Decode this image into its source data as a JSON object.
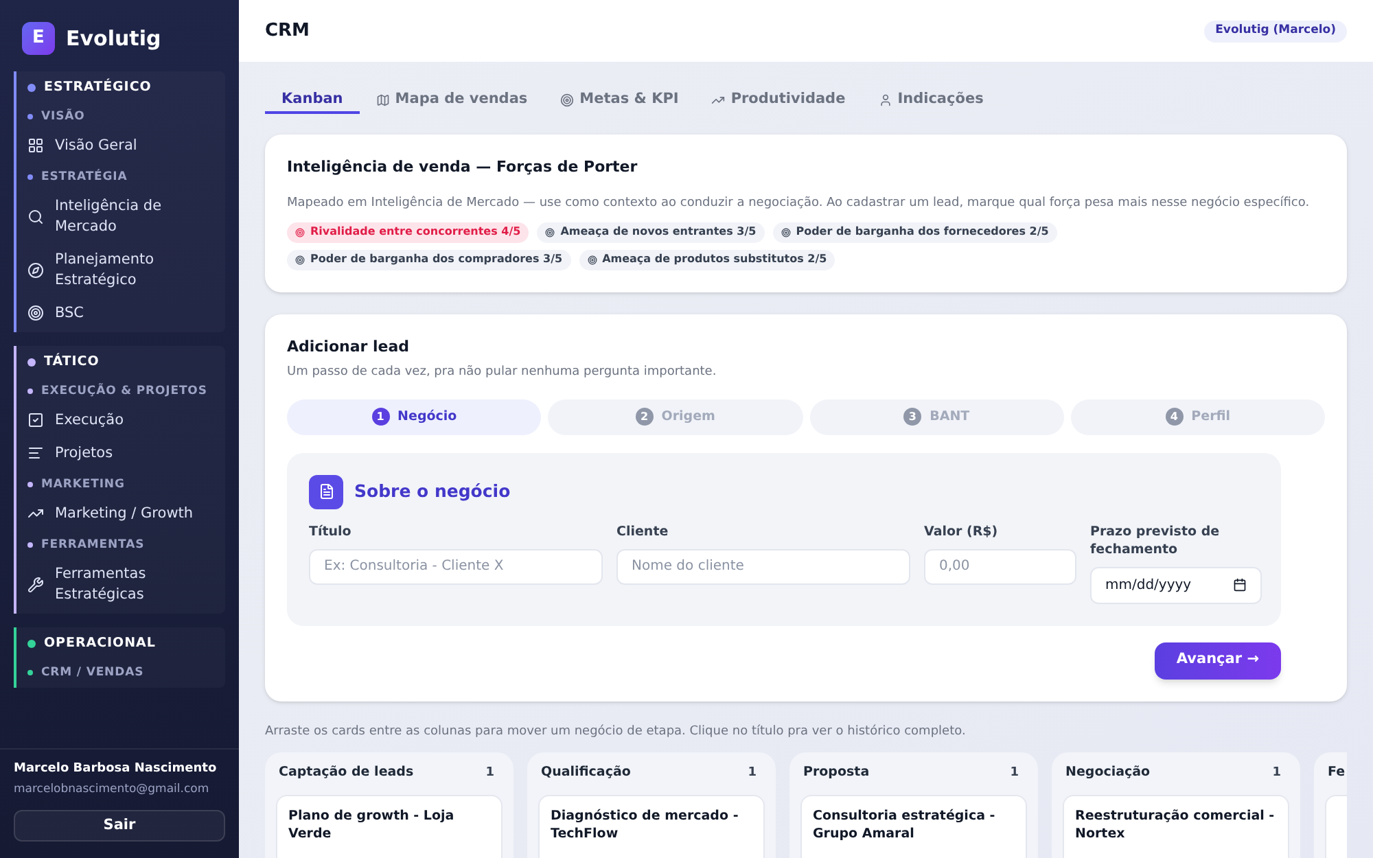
{
  "sidebar": {
    "brand": {
      "letter": "E",
      "name": "Evolutig"
    },
    "groups": [
      {
        "title": "ESTRATÉGICO",
        "color": "#818cf8",
        "sections": [
          {
            "title": "VISÃO",
            "items": [
              {
                "label": "Visão Geral"
              }
            ]
          },
          {
            "title": "ESTRATÉGIA",
            "items": [
              {
                "label": "Inteligência de Mercado"
              },
              {
                "label": "Planejamento Estratégico"
              },
              {
                "label": "BSC"
              }
            ]
          }
        ]
      },
      {
        "title": "TÁTICO",
        "color": "#c4b5fd",
        "sections": [
          {
            "title": "EXECUÇÃO & PROJETOS",
            "items": [
              {
                "label": "Execução"
              },
              {
                "label": "Projetos"
              }
            ]
          },
          {
            "title": "MARKETING",
            "items": [
              {
                "label": "Marketing / Growth"
              }
            ]
          },
          {
            "title": "FERRAMENTAS",
            "items": [
              {
                "label": "Ferramentas Estratégicas"
              }
            ]
          }
        ]
      },
      {
        "title": "OPERACIONAL",
        "color": "#34d399",
        "sections": [
          {
            "title": "CRM / VENDAS"
          }
        ]
      }
    ],
    "user": {
      "name": "Marcelo Barbosa Nascimento",
      "email": "marcelobnascimento@gmail.com",
      "logout": "Sair"
    }
  },
  "header": {
    "title": "CRM",
    "badge": "Evolutig (Marcelo)"
  },
  "tabs": [
    {
      "label": "Kanban",
      "selected": true
    },
    {
      "label": "Mapa de vendas",
      "selected": false
    },
    {
      "label": "Metas & KPI",
      "selected": false
    },
    {
      "label": "Produtividade",
      "selected": false
    },
    {
      "label": "Indicações",
      "selected": false
    }
  ],
  "porter": {
    "title": "Inteligência de venda — Forças de Porter",
    "description": "Mapeado em Inteligência de Mercado — use como contexto ao conduzir a negociação. Ao cadastrar um lead, marque qual força pesa mais nesse negócio específico.",
    "forces": [
      {
        "label": "Rivalidade entre concorrentes 4/5",
        "highlighted": true
      },
      {
        "label": "Ameaça de novos entrantes 3/5",
        "highlighted": false
      },
      {
        "label": "Poder de barganha dos fornecedores 2/5",
        "highlighted": false
      },
      {
        "label": "Poder de barganha dos compradores 3/5",
        "highlighted": false
      },
      {
        "label": "Ameaça de produtos substitutos 2/5",
        "highlighted": false
      }
    ]
  },
  "lead_form": {
    "title": "Adicionar lead",
    "subtitle": "Um passo de cada vez, pra não pular nenhuma pergunta importante.",
    "steps": [
      {
        "number": "1",
        "label": "Negócio",
        "selected": true
      },
      {
        "number": "2",
        "label": "Origem",
        "selected": false
      },
      {
        "number": "3",
        "label": "BANT",
        "selected": false
      },
      {
        "number": "4",
        "label": "Perfil",
        "selected": false
      }
    ],
    "section_title": "Sobre o negócio",
    "fields": [
      {
        "label": "Título",
        "kind": "text",
        "placeholder": "Ex: Consultoria - Cliente X"
      },
      {
        "label": "Cliente",
        "kind": "text",
        "placeholder": "Nome do cliente"
      },
      {
        "label": "Valor (R$)",
        "kind": "text",
        "placeholder": "0,00"
      },
      {
        "label": "Prazo previsto de fechamento",
        "kind": "date",
        "placeholder": "mm/dd/yyyy"
      }
    ],
    "next_button": "Avançar →"
  },
  "kanban": {
    "hint": "Arraste os cards entre as colunas para mover um negócio de etapa. Clique no título pra ver o histórico completo.",
    "columns": [
      {
        "title": "Captação de leads",
        "count": "1",
        "cards": [
          "Plano de growth - Loja Verde"
        ]
      },
      {
        "title": "Qualificação",
        "count": "1",
        "cards": [
          "Diagnóstico de mercado - TechFlow"
        ]
      },
      {
        "title": "Proposta",
        "count": "1",
        "cards": [
          "Consultoria estratégica - Grupo Amaral"
        ]
      },
      {
        "title": "Negociação",
        "count": "1",
        "cards": [
          "Reestruturação comercial - Nortex"
        ]
      },
      {
        "title": "Fe"
      }
    ]
  }
}
